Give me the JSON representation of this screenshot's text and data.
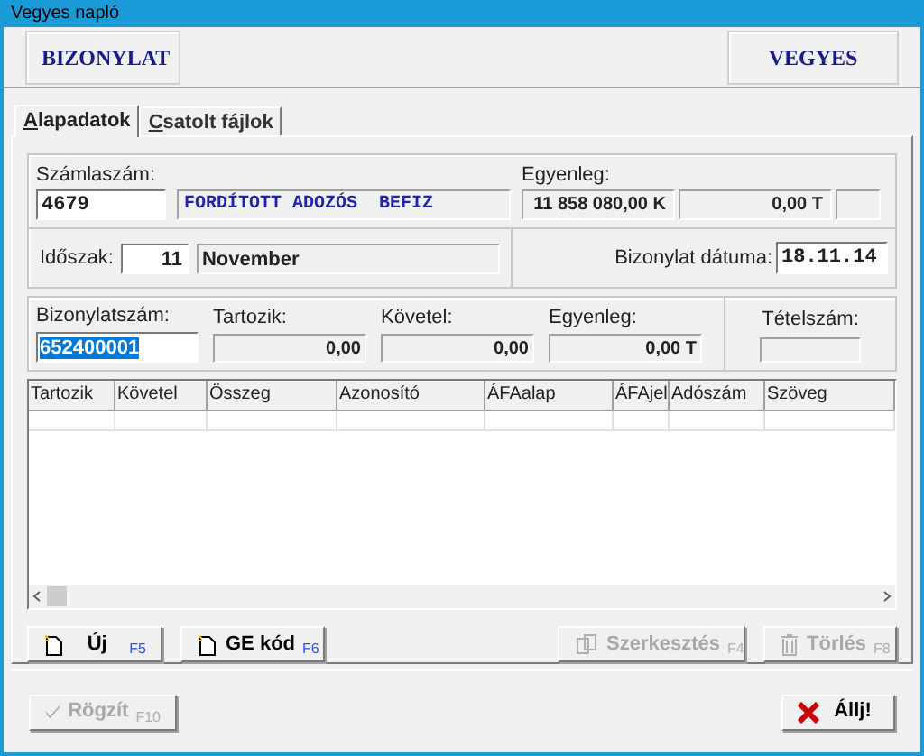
{
  "window": {
    "title": "Vegyes napló"
  },
  "header": {
    "left": "BIZONYLAT",
    "right": "VEGYES"
  },
  "tabs": [
    {
      "label": "Alapadatok",
      "selected": true
    },
    {
      "label": "Csatolt fájlok",
      "selected": false
    }
  ],
  "account": {
    "label": "Számlaszám:",
    "number": "4679",
    "name": "FORDÍTOTT ADOZÓS  BEFIZ"
  },
  "balance": {
    "label": "Egyenleg:",
    "debit": "11 858 080,00 K",
    "credit": "0,00 T"
  },
  "period": {
    "label": "Időszak:",
    "number": "11",
    "month": "November"
  },
  "date": {
    "label": "Bizonylat dátuma:",
    "value": "18.11.14"
  },
  "document": {
    "label": "Bizonylatszám:",
    "number": "652400001"
  },
  "totals": [
    {
      "label": "Tartozik:",
      "value": "0,00"
    },
    {
      "label": "Követel:",
      "value": "0,00"
    },
    {
      "label": "Egyenleg:",
      "value": "0,00 T"
    }
  ],
  "item_number": {
    "label": "Tételszám:"
  },
  "table": {
    "columns": [
      "Tartozik",
      "Követel",
      "Összeg",
      "Azonosító",
      "ÁFAalap",
      "ÁFAjel",
      "Adószám",
      "Szöveg"
    ]
  },
  "actions": [
    {
      "label": "Új",
      "shortcut": "F5",
      "disabled": false,
      "kind": "new"
    },
    {
      "label": "GE kód",
      "shortcut": "F6",
      "disabled": false,
      "kind": "new"
    },
    {
      "label": "Szerkesztés",
      "shortcut": "F4",
      "disabled": true,
      "kind": "edit"
    },
    {
      "label": "Törlés",
      "shortcut": "F8",
      "disabled": true,
      "kind": "delete"
    }
  ],
  "footer": [
    {
      "label": "Rögzít",
      "shortcut": "F10",
      "disabled": true,
      "kind": "save"
    },
    {
      "label": "Állj!",
      "disabled": false,
      "kind": "cancel"
    }
  ]
}
